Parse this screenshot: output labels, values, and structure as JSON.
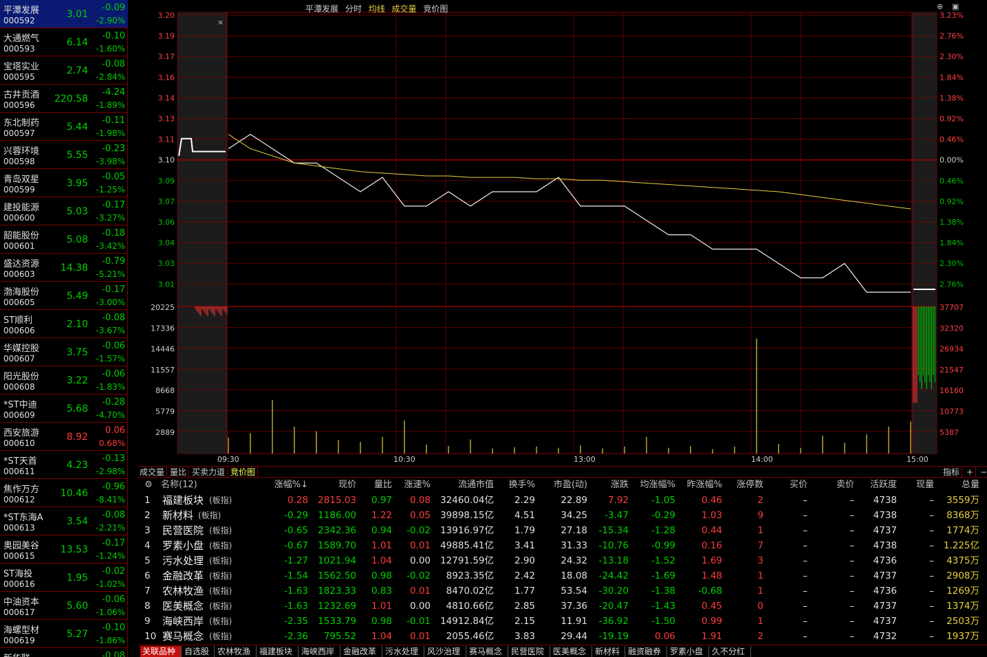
{
  "sidebar": {
    "items": [
      {
        "name": "平潭发展",
        "code": "000592",
        "price": "3.01",
        "change": "-0.09",
        "pct": "-2.90%",
        "dir": "down",
        "selected": true
      },
      {
        "name": "大通燃气",
        "code": "000593",
        "price": "6.14",
        "change": "-0.10",
        "pct": "-1.60%",
        "dir": "down"
      },
      {
        "name": "宝塔实业",
        "code": "000595",
        "price": "2.74",
        "change": "-0.08",
        "pct": "-2.84%",
        "dir": "down"
      },
      {
        "name": "古井贡酒",
        "code": "000596",
        "price": "220.58",
        "change": "-4.24",
        "pct": "-1.89%",
        "dir": "down"
      },
      {
        "name": "东北制药",
        "code": "000597",
        "price": "5.44",
        "change": "-0.11",
        "pct": "-1.98%",
        "dir": "down"
      },
      {
        "name": "兴蓉环境",
        "code": "000598",
        "price": "5.55",
        "change": "-0.23",
        "pct": "-3.98%",
        "dir": "down"
      },
      {
        "name": "青岛双星",
        "code": "000599",
        "price": "3.95",
        "change": "-0.05",
        "pct": "-1.25%",
        "dir": "down"
      },
      {
        "name": "建投能源",
        "code": "000600",
        "price": "5.03",
        "change": "-0.17",
        "pct": "-3.27%",
        "dir": "down"
      },
      {
        "name": "韶能股份",
        "code": "000601",
        "price": "5.08",
        "change": "-0.18",
        "pct": "-3.42%",
        "dir": "down"
      },
      {
        "name": "盛达资源",
        "code": "000603",
        "price": "14.38",
        "change": "-0.79",
        "pct": "-5.21%",
        "dir": "down"
      },
      {
        "name": "渤海股份",
        "code": "000605",
        "price": "5.49",
        "change": "-0.17",
        "pct": "-3.00%",
        "dir": "down"
      },
      {
        "name": "ST顺利",
        "code": "000606",
        "price": "2.10",
        "change": "-0.08",
        "pct": "-3.67%",
        "dir": "down"
      },
      {
        "name": "华媒控股",
        "code": "000607",
        "price": "3.75",
        "change": "-0.06",
        "pct": "-1.57%",
        "dir": "down"
      },
      {
        "name": "阳光股份",
        "code": "000608",
        "price": "3.22",
        "change": "-0.06",
        "pct": "-1.83%",
        "dir": "down"
      },
      {
        "name": "*ST中迪",
        "code": "000609",
        "price": "5.68",
        "change": "-0.28",
        "pct": "-4.70%",
        "dir": "down"
      },
      {
        "name": "西安旅游",
        "code": "000610",
        "price": "8.92",
        "change": "0.06",
        "pct": "0.68%",
        "dir": "up"
      },
      {
        "name": "*ST天首",
        "code": "000611",
        "price": "4.23",
        "change": "-0.13",
        "pct": "-2.98%",
        "dir": "down"
      },
      {
        "name": "焦作万方",
        "code": "000612",
        "price": "10.46",
        "change": "-0.96",
        "pct": "-8.41%",
        "dir": "down"
      },
      {
        "name": "*ST东海A",
        "code": "000613",
        "price": "3.54",
        "change": "-0.08",
        "pct": "-2.21%",
        "dir": "down"
      },
      {
        "name": "奥园美谷",
        "code": "000615",
        "price": "13.53",
        "change": "-0.17",
        "pct": "-1.24%",
        "dir": "down"
      },
      {
        "name": "ST海投",
        "code": "000616",
        "price": "1.95",
        "change": "-0.02",
        "pct": "-1.02%",
        "dir": "down"
      },
      {
        "name": "中油资本",
        "code": "000617",
        "price": "5.60",
        "change": "-0.06",
        "pct": "-1.06%",
        "dir": "down"
      },
      {
        "name": "海螺型材",
        "code": "000619",
        "price": "5.27",
        "change": "-0.10",
        "pct": "-1.86%",
        "dir": "down"
      },
      {
        "name": "新华联",
        "code": "",
        "price": "",
        "change": "-0.08",
        "pct": "",
        "dir": "down"
      }
    ]
  },
  "chart_header": {
    "stock": "平潭发展",
    "mode": "分时",
    "avg": "均线",
    "vol": "成交量",
    "bid": "竞价图"
  },
  "chart_data": {
    "type": "line",
    "price_axis": [
      "3.20",
      "3.19",
      "3.17",
      "3.16",
      "3.14",
      "3.13",
      "3.11",
      "3.10",
      "3.09",
      "3.07",
      "3.06",
      "3.04",
      "3.03",
      "3.01"
    ],
    "pct_axis": [
      "3.23%",
      "2.76%",
      "2.30%",
      "1.84%",
      "1.38%",
      "0.92%",
      "0.46%",
      "0.00%",
      "0.46%",
      "0.92%",
      "1.38%",
      "1.84%",
      "2.30%",
      "2.76%"
    ],
    "vol_axis": [
      "20225",
      "17336",
      "14446",
      "11557",
      "8668",
      "5779",
      "2889"
    ],
    "vol_axis_right": [
      "37707",
      "32320",
      "26934",
      "21547",
      "16160",
      "10773",
      "5387"
    ],
    "time_labels": [
      "09:30",
      "10:30",
      "13:00",
      "14:00",
      "15:00"
    ],
    "prev_close": 3.1,
    "price_series": [
      3.11,
      3.12,
      3.11,
      3.1,
      3.1,
      3.09,
      3.08,
      3.09,
      3.07,
      3.07,
      3.08,
      3.07,
      3.08,
      3.08,
      3.08,
      3.09,
      3.07,
      3.07,
      3.07,
      3.06,
      3.05,
      3.05,
      3.04,
      3.04,
      3.04,
      3.03,
      3.02,
      3.02,
      3.03,
      3.01,
      3.01,
      3.01
    ],
    "avg_series": [
      3.12,
      3.11,
      3.105,
      3.1,
      3.098,
      3.096,
      3.094,
      3.093,
      3.092,
      3.091,
      3.091,
      3.09,
      3.09,
      3.09,
      3.089,
      3.089,
      3.088,
      3.088,
      3.087,
      3.086,
      3.085,
      3.084,
      3.083,
      3.082,
      3.081,
      3.08,
      3.078,
      3.076,
      3.074,
      3.072,
      3.07,
      3.068
    ],
    "series": [
      {
        "name": "均线",
        "values": [
          3.12,
          3.11,
          3.105,
          3.1,
          3.098,
          3.096,
          3.094,
          3.093,
          3.092,
          3.091,
          3.091,
          3.09,
          3.09,
          3.09,
          3.089,
          3.089,
          3.088,
          3.088,
          3.087,
          3.086,
          3.085,
          3.084,
          3.083,
          3.082,
          3.081,
          3.08,
          3.078,
          3.076,
          3.074,
          3.072,
          3.07,
          3.068
        ]
      }
    ],
    "volume_series": [
      2500,
      3200,
      8400,
      4200,
      3500,
      2100,
      1800,
      2600,
      5200,
      1400,
      1200,
      2200,
      800,
      1000,
      1100,
      900,
      1300,
      800,
      1100,
      2600,
      900,
      1200,
      700,
      1100,
      18000,
      1500,
      900,
      2800,
      1700,
      3000,
      4200,
      5000
    ]
  },
  "tabs": [
    "成交量",
    "量比",
    "买卖力道",
    "竞价图"
  ],
  "right_tabs": {
    "index": "指标",
    "plus": "+",
    "minus": "−"
  },
  "table": {
    "headers": [
      "名称(12)",
      "涨幅%↓",
      "现价",
      "量比",
      "涨速%",
      "流通市值",
      "换手%",
      "市盈(动)",
      "涨跌",
      "均涨幅%",
      "昨涨幅%",
      "涨停数",
      "买价",
      "卖价",
      "活跃度",
      "现量",
      "总量"
    ],
    "rows": [
      [
        "1",
        "福建板块",
        "(板指)",
        "0.28",
        "2815.03",
        "0.97",
        "0.08",
        "32460.04亿",
        "2.29",
        "22.89",
        "7.92",
        "-1.05",
        "0.46",
        "2",
        "–",
        "–",
        "4738",
        "–",
        "3559万"
      ],
      [
        "2",
        "新材料",
        "(板指)",
        "-0.29",
        "1186.00",
        "1.22",
        "0.05",
        "39898.15亿",
        "4.51",
        "34.25",
        "-3.47",
        "-0.29",
        "1.03",
        "9",
        "–",
        "–",
        "4738",
        "–",
        "8368万"
      ],
      [
        "3",
        "民营医院",
        "(板指)",
        "-0.65",
        "2342.36",
        "0.94",
        "-0.02",
        "13916.97亿",
        "1.79",
        "27.18",
        "-15.34",
        "-1.28",
        "0.44",
        "1",
        "–",
        "–",
        "4737",
        "–",
        "1774万"
      ],
      [
        "4",
        "罗素小盘",
        "(板指)",
        "-0.67",
        "1589.70",
        "1.01",
        "0.01",
        "49885.41亿",
        "3.41",
        "31.33",
        "-10.76",
        "-0.99",
        "0.16",
        "7",
        "–",
        "–",
        "4738",
        "–",
        "1.225亿"
      ],
      [
        "5",
        "污水处理",
        "(板指)",
        "-1.27",
        "1021.94",
        "1.04",
        "0.00",
        "12791.59亿",
        "2.90",
        "24.32",
        "-13.18",
        "-1.52",
        "1.69",
        "3",
        "–",
        "–",
        "4736",
        "–",
        "4375万"
      ],
      [
        "6",
        "金融改革",
        "(板指)",
        "-1.54",
        "1562.50",
        "0.98",
        "-0.02",
        "8923.35亿",
        "2.42",
        "18.08",
        "-24.42",
        "-1.69",
        "1.48",
        "1",
        "–",
        "–",
        "4737",
        "–",
        "2908万"
      ],
      [
        "7",
        "农林牧渔",
        "(板指)",
        "-1.63",
        "1823.33",
        "0.83",
        "0.01",
        "8470.02亿",
        "1.77",
        "53.54",
        "-30.20",
        "-1.38",
        "-0.68",
        "1",
        "–",
        "–",
        "4736",
        "–",
        "1269万"
      ],
      [
        "8",
        "医美概念",
        "(板指)",
        "-1.63",
        "1232.69",
        "1.01",
        "0.00",
        "4810.66亿",
        "2.85",
        "37.36",
        "-20.47",
        "-1.43",
        "0.45",
        "0",
        "–",
        "–",
        "4737",
        "–",
        "1374万"
      ],
      [
        "9",
        "海峡西岸",
        "(板指)",
        "-2.35",
        "1533.79",
        "0.98",
        "-0.01",
        "14912.84亿",
        "2.15",
        "11.91",
        "-36.92",
        "-1.50",
        "0.99",
        "1",
        "–",
        "–",
        "4737",
        "–",
        "2503万"
      ],
      [
        "10",
        "赛马概念",
        "(板指)",
        "-2.36",
        "795.52",
        "1.04",
        "0.01",
        "2055.46亿",
        "3.83",
        "29.44",
        "-19.19",
        "0.06",
        "1.91",
        "2",
        "–",
        "–",
        "4732",
        "–",
        "1937万"
      ]
    ]
  },
  "bottom_tabs": [
    "关联品种",
    "自选股",
    "农林牧渔",
    "福建板块",
    "海峡西岸",
    "金融改革",
    "污水处理",
    "风沙治理",
    "赛马概念",
    "民营医院",
    "医美概念",
    "新材料",
    "融资融券",
    "罗素小盘",
    "久不分红"
  ]
}
